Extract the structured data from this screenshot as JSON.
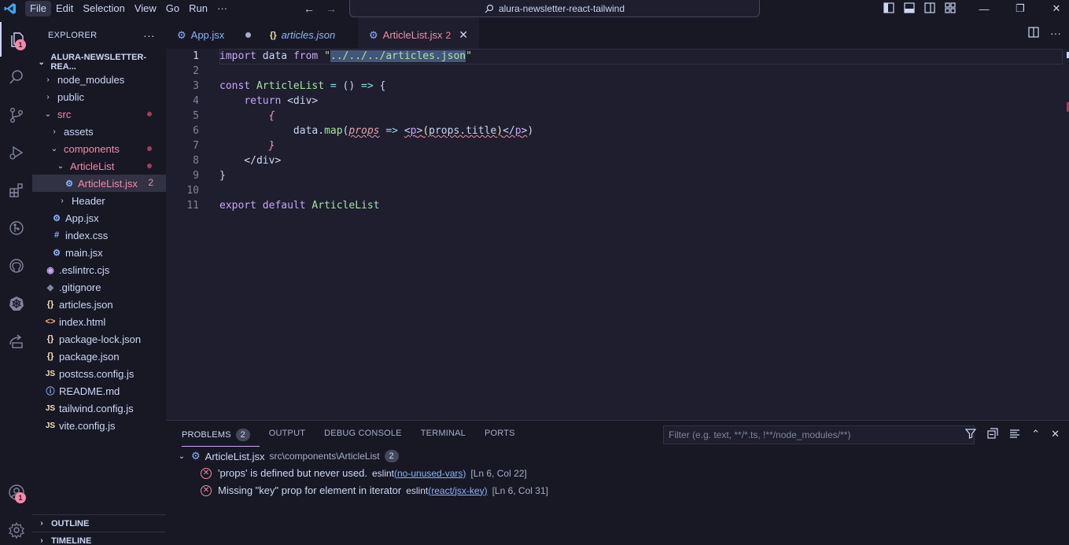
{
  "titlebar": {
    "menu": [
      "File",
      "Edit",
      "Selection",
      "View",
      "Go",
      "Run",
      "···"
    ],
    "search_text": "alura-newsletter-react-tailwind"
  },
  "activity": {
    "explorer_badge": "1",
    "account_badge": "1"
  },
  "sidebar": {
    "title": "EXPLORER",
    "more": "···",
    "project": "ALURA-NEWSLETTER-REA...",
    "items": [
      {
        "label": "node_modules"
      },
      {
        "label": "public"
      },
      {
        "label": "src"
      },
      {
        "label": "assets"
      },
      {
        "label": "components"
      },
      {
        "label": "ArticleList"
      },
      {
        "label": "ArticleList.jsx",
        "count": "2"
      },
      {
        "label": "Header"
      },
      {
        "label": "App.jsx"
      },
      {
        "label": "index.css"
      },
      {
        "label": "main.jsx"
      },
      {
        "label": ".eslintrc.cjs"
      },
      {
        "label": ".gitignore"
      },
      {
        "label": "articles.json"
      },
      {
        "label": "index.html"
      },
      {
        "label": "package-lock.json"
      },
      {
        "label": "package.json"
      },
      {
        "label": "postcss.config.js"
      },
      {
        "label": "README.md"
      },
      {
        "label": "tailwind.config.js"
      },
      {
        "label": "vite.config.js"
      }
    ],
    "outline": "OUTLINE",
    "timeline": "TIMELINE"
  },
  "tabs": [
    {
      "label": "App.jsx"
    },
    {
      "label": "articles.json"
    },
    {
      "label": "ArticleList.jsx",
      "count": "2"
    }
  ],
  "editor": {
    "line_numbers": [
      "1",
      "2",
      "3",
      "4",
      "5",
      "6",
      "7",
      "8",
      "9",
      "10",
      "11"
    ]
  },
  "panel": {
    "tabs": [
      "PROBLEMS",
      "OUTPUT",
      "DEBUG CONSOLE",
      "TERMINAL",
      "PORTS"
    ],
    "problems_count": "2",
    "filter_placeholder": "Filter (e.g. text, **/*.ts, !**/node_modules/**)",
    "file": {
      "name": "ArticleList.jsx",
      "path": "src\\components\\ArticleList",
      "count": "2"
    },
    "problems": [
      {
        "message": "'props' is defined but never used.",
        "source": "eslint",
        "rule": "(no-unused-vars)",
        "location": "[Ln 6, Col 22]"
      },
      {
        "message": "Missing \"key\" prop for element in iterator",
        "source": "eslint",
        "rule": "(react/jsx-key)",
        "location": "[Ln 6, Col 31]"
      }
    ]
  },
  "colors": {
    "accent": "#cba6f7",
    "error": "#f38ba8",
    "background": "#1e1e2e"
  }
}
